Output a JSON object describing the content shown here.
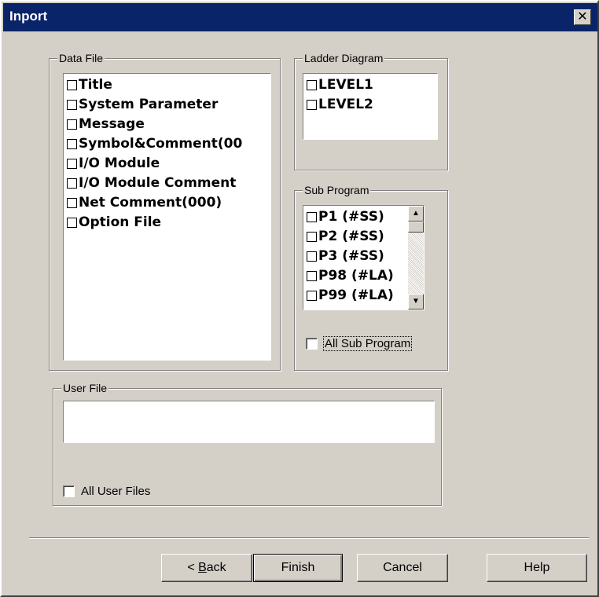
{
  "window": {
    "title": "Inport",
    "close_glyph": "✕"
  },
  "data_file": {
    "label": "Data File",
    "items": [
      "Title",
      "System Parameter",
      "Message",
      "Symbol&Comment(00",
      "I/O Module",
      "I/O Module Comment",
      "Net Comment(000)",
      "Option File"
    ]
  },
  "ladder_diagram": {
    "label": "Ladder Diagram",
    "items": [
      "LEVEL1",
      "LEVEL2"
    ]
  },
  "sub_program": {
    "label": "Sub Program",
    "items": [
      "P1 (#SS)",
      "P2 (#SS)",
      "P3 (#SS)",
      "P98 (#LA)",
      "P99 (#LA)"
    ],
    "all_label": "All Sub Program",
    "all_checked": false
  },
  "user_file": {
    "label": "User File",
    "all_label": "All User Files",
    "all_checked": false
  },
  "buttons": {
    "back_prefix": "< ",
    "back_accel": "B",
    "back_rest": "ack",
    "finish": "Finish",
    "cancel": "Cancel",
    "help": "Help"
  }
}
